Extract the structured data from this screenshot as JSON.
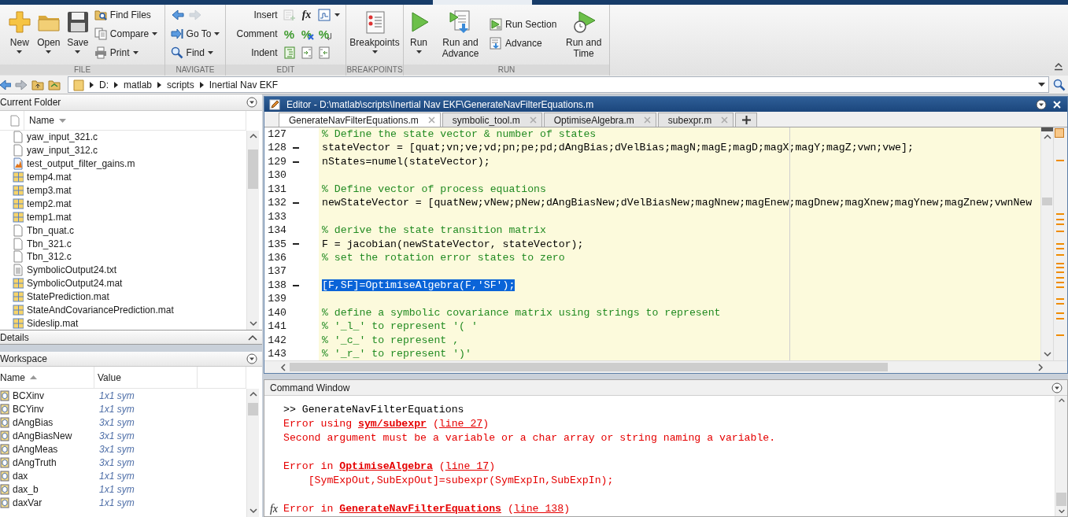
{
  "toolstrip": {
    "sections": [
      {
        "label": "FILE",
        "groups": [
          {
            "kind": "large",
            "label": "New",
            "dropdown": true
          },
          {
            "kind": "large",
            "label": "Open",
            "dropdown": true
          },
          {
            "kind": "large",
            "label": "Save",
            "dropdown": true
          },
          {
            "kind": "stack",
            "items": [
              {
                "kind": "button",
                "label": "Find Files",
                "dropdown": false
              },
              {
                "kind": "button",
                "label": "Compare",
                "dropdown": true
              },
              {
                "kind": "button",
                "label": "Print",
                "dropdown": true
              }
            ]
          }
        ]
      },
      {
        "label": "NAVIGATE",
        "groups": [
          {
            "kind": "stack",
            "items": [
              {
                "kind": "icons",
                "icons": [
                  {
                    "disabled": false
                  },
                  {
                    "disabled": true
                  }
                ],
                "dropdown": false
              },
              {
                "kind": "button",
                "label": "Go To",
                "dropdown": true
              },
              {
                "kind": "button",
                "label": "Find",
                "dropdown": true
              }
            ]
          }
        ]
      },
      {
        "label": "EDIT",
        "groups": [
          {
            "kind": "stack",
            "items": [
              {
                "kind": "icons",
                "label": "Insert",
                "icons": [
                  {
                    "disabled": true
                  },
                  {
                    "text": "fx",
                    "disabled": false
                  },
                  {
                    "disabled": false
                  }
                ],
                "dropdown": true
              },
              {
                "kind": "icons",
                "label": "Comment",
                "icons": [
                  {
                    "text": "%",
                    "disabled": false
                  },
                  {
                    "text": "%",
                    "disabled": false
                  },
                  {
                    "text": "%",
                    "disabled": false
                  }
                ],
                "dropdown": false
              },
              {
                "kind": "icons",
                "label": "Indent",
                "icons": [
                  {
                    "disabled": false
                  },
                  {
                    "disabled": false
                  },
                  {
                    "disabled": false
                  }
                ],
                "dropdown": false
              }
            ]
          }
        ]
      },
      {
        "label": "BREAKPOINTS",
        "groups": [
          {
            "kind": "large",
            "label": "Breakpoints",
            "dropdown": true
          }
        ]
      },
      {
        "label": "RUN",
        "groups": [
          {
            "kind": "large",
            "label": "Run",
            "dropdown": true
          },
          {
            "kind": "large",
            "label": "Run and Advance",
            "dropdown": false
          },
          {
            "kind": "stack",
            "items": [
              {
                "kind": "button",
                "label": "Run Section",
                "dropdown": false
              },
              {
                "kind": "button",
                "label": "Advance",
                "dropdown": false
              }
            ]
          },
          {
            "kind": "large",
            "label": "Run and Time",
            "dropdown": false
          }
        ]
      }
    ]
  },
  "address_bar": {
    "path": [
      "D:",
      "matlab",
      "scripts",
      "Inertial Nav EKF"
    ]
  },
  "current_folder": {
    "title": "Current Folder",
    "column": "Name",
    "files": [
      {
        "name": "yaw_input_321.c",
        "kind": "c"
      },
      {
        "name": "yaw_input_312.c",
        "kind": "c"
      },
      {
        "name": "test_output_filter_gains.m",
        "kind": "m"
      },
      {
        "name": "temp4.mat",
        "kind": "mat"
      },
      {
        "name": "temp3.mat",
        "kind": "mat"
      },
      {
        "name": "temp2.mat",
        "kind": "mat"
      },
      {
        "name": "temp1.mat",
        "kind": "mat"
      },
      {
        "name": "Tbn_quat.c",
        "kind": "c"
      },
      {
        "name": "Tbn_321.c",
        "kind": "c"
      },
      {
        "name": "Tbn_312.c",
        "kind": "c"
      },
      {
        "name": "SymbolicOutput24.txt",
        "kind": "txt"
      },
      {
        "name": "SymbolicOutput24.mat",
        "kind": "mat"
      },
      {
        "name": "StatePrediction.mat",
        "kind": "mat"
      },
      {
        "name": "StateAndCovariancePrediction.mat",
        "kind": "mat"
      },
      {
        "name": "Sideslip.mat",
        "kind": "mat"
      }
    ]
  },
  "details": {
    "title": "Details"
  },
  "workspace": {
    "title": "Workspace",
    "columns": [
      "Name",
      "Value"
    ],
    "rows": [
      {
        "name": "BCXinv",
        "value": "1x1 sym"
      },
      {
        "name": "BCYinv",
        "value": "1x1 sym"
      },
      {
        "name": "dAngBias",
        "value": "3x1 sym"
      },
      {
        "name": "dAngBiasNew",
        "value": "3x1 sym"
      },
      {
        "name": "dAngMeas",
        "value": "3x1 sym"
      },
      {
        "name": "dAngTruth",
        "value": "3x1 sym"
      },
      {
        "name": "dax",
        "value": "1x1 sym"
      },
      {
        "name": "dax_b",
        "value": "1x1 sym"
      },
      {
        "name": "daxVar",
        "value": "1x1 sym"
      }
    ]
  },
  "editor": {
    "title": "Editor - D:\\matlab\\scripts\\Inertial Nav EKF\\GenerateNavFilterEquations.m",
    "tabs": [
      {
        "label": "GenerateNavFilterEquations.m",
        "selected": true
      },
      {
        "label": "symbolic_tool.m",
        "selected": false
      },
      {
        "label": "OptimiseAlgebra.m",
        "selected": false
      },
      {
        "label": "subexpr.m",
        "selected": false
      }
    ],
    "lines": [
      {
        "number": "127",
        "kind": "comment",
        "text": "% Define the state vector & number of states",
        "executable": false,
        "selected": false
      },
      {
        "number": "128",
        "kind": "code",
        "text": "stateVector = [quat;vn;ve;vd;pn;pe;pd;dAngBias;dVelBias;magN;magE;magD;magX;magY;magZ;vwn;vwe];",
        "executable": true,
        "selected": false
      },
      {
        "number": "129",
        "kind": "code",
        "text": "nStates=numel(stateVector);",
        "executable": true,
        "selected": false
      },
      {
        "number": "130",
        "kind": "blank",
        "executable": false,
        "selected": false
      },
      {
        "number": "131",
        "kind": "comment",
        "text": "% Define vector of process equations",
        "executable": false,
        "selected": false
      },
      {
        "number": "132",
        "kind": "code",
        "text": "newStateVector = [quatNew;vNew;pNew;dAngBiasNew;dVelBiasNew;magNnew;magEnew;magDnew;magXnew;magYnew;magZnew;vwnNew",
        "executable": true,
        "selected": false
      },
      {
        "number": "133",
        "kind": "blank",
        "executable": false,
        "selected": false
      },
      {
        "number": "134",
        "kind": "comment",
        "text": "% derive the state transition matrix",
        "executable": false,
        "selected": false
      },
      {
        "number": "135",
        "kind": "code",
        "text": "F = jacobian(newStateVector, stateVector);",
        "executable": true,
        "selected": false
      },
      {
        "number": "136",
        "kind": "comment",
        "text": "% set the rotation error states to zero",
        "executable": false,
        "selected": false
      },
      {
        "number": "137",
        "kind": "blank",
        "executable": false,
        "selected": false
      },
      {
        "number": "138",
        "kind": "code",
        "text": "[F,SF]=OptimiseAlgebra(F,'SF');",
        "executable": true,
        "selected": true
      },
      {
        "number": "139",
        "kind": "blank",
        "executable": false,
        "selected": false
      },
      {
        "number": "140",
        "kind": "comment",
        "text": "% define a symbolic covariance matrix using strings to represent",
        "executable": false,
        "selected": false
      },
      {
        "number": "141",
        "kind": "comment",
        "text": "% '_l_' to represent '( '",
        "executable": false,
        "selected": false
      },
      {
        "number": "142",
        "kind": "comment",
        "text": "% '_c_' to represent ,",
        "executable": false,
        "selected": false
      },
      {
        "number": "143",
        "kind": "comment",
        "text": "% '_r_' to represent ')'",
        "executable": false,
        "selected": false
      }
    ]
  },
  "command_window": {
    "title": "Command Window",
    "prompt_icon": "fx",
    "lines": [
      {
        "kind": "input",
        "parts": [
          {
            "text": ">> GenerateNavFilterEquations"
          }
        ]
      },
      {
        "kind": "error",
        "parts": [
          {
            "text": "Error using "
          },
          {
            "text": "sym/subexpr",
            "link": true,
            "bold": true
          },
          {
            "text": " ("
          },
          {
            "text": "line 27",
            "link": true,
            "bold": false
          },
          {
            "text": ")"
          }
        ]
      },
      {
        "kind": "error",
        "parts": [
          {
            "text": "Second argument must be a variable or a char array or string naming a variable."
          }
        ]
      },
      {
        "kind": "blank"
      },
      {
        "kind": "error",
        "parts": [
          {
            "text": "Error in "
          },
          {
            "text": "OptimiseAlgebra",
            "link": true,
            "bold": true
          },
          {
            "text": " ("
          },
          {
            "text": "line 17",
            "link": true,
            "bold": false
          },
          {
            "text": ")"
          }
        ]
      },
      {
        "kind": "error_detail",
        "parts": [
          {
            "text": "[SymExpOut,SubExpOut]=subexpr(SymExpIn,SubExpIn);"
          }
        ]
      },
      {
        "kind": "blank"
      },
      {
        "kind": "error",
        "parts": [
          {
            "text": "Error in "
          },
          {
            "text": "GenerateNavFilterEquations",
            "link": true,
            "bold": true
          },
          {
            "text": " ("
          },
          {
            "text": "line 138",
            "link": true,
            "bold": false
          },
          {
            "text": ")"
          }
        ]
      }
    ]
  }
}
